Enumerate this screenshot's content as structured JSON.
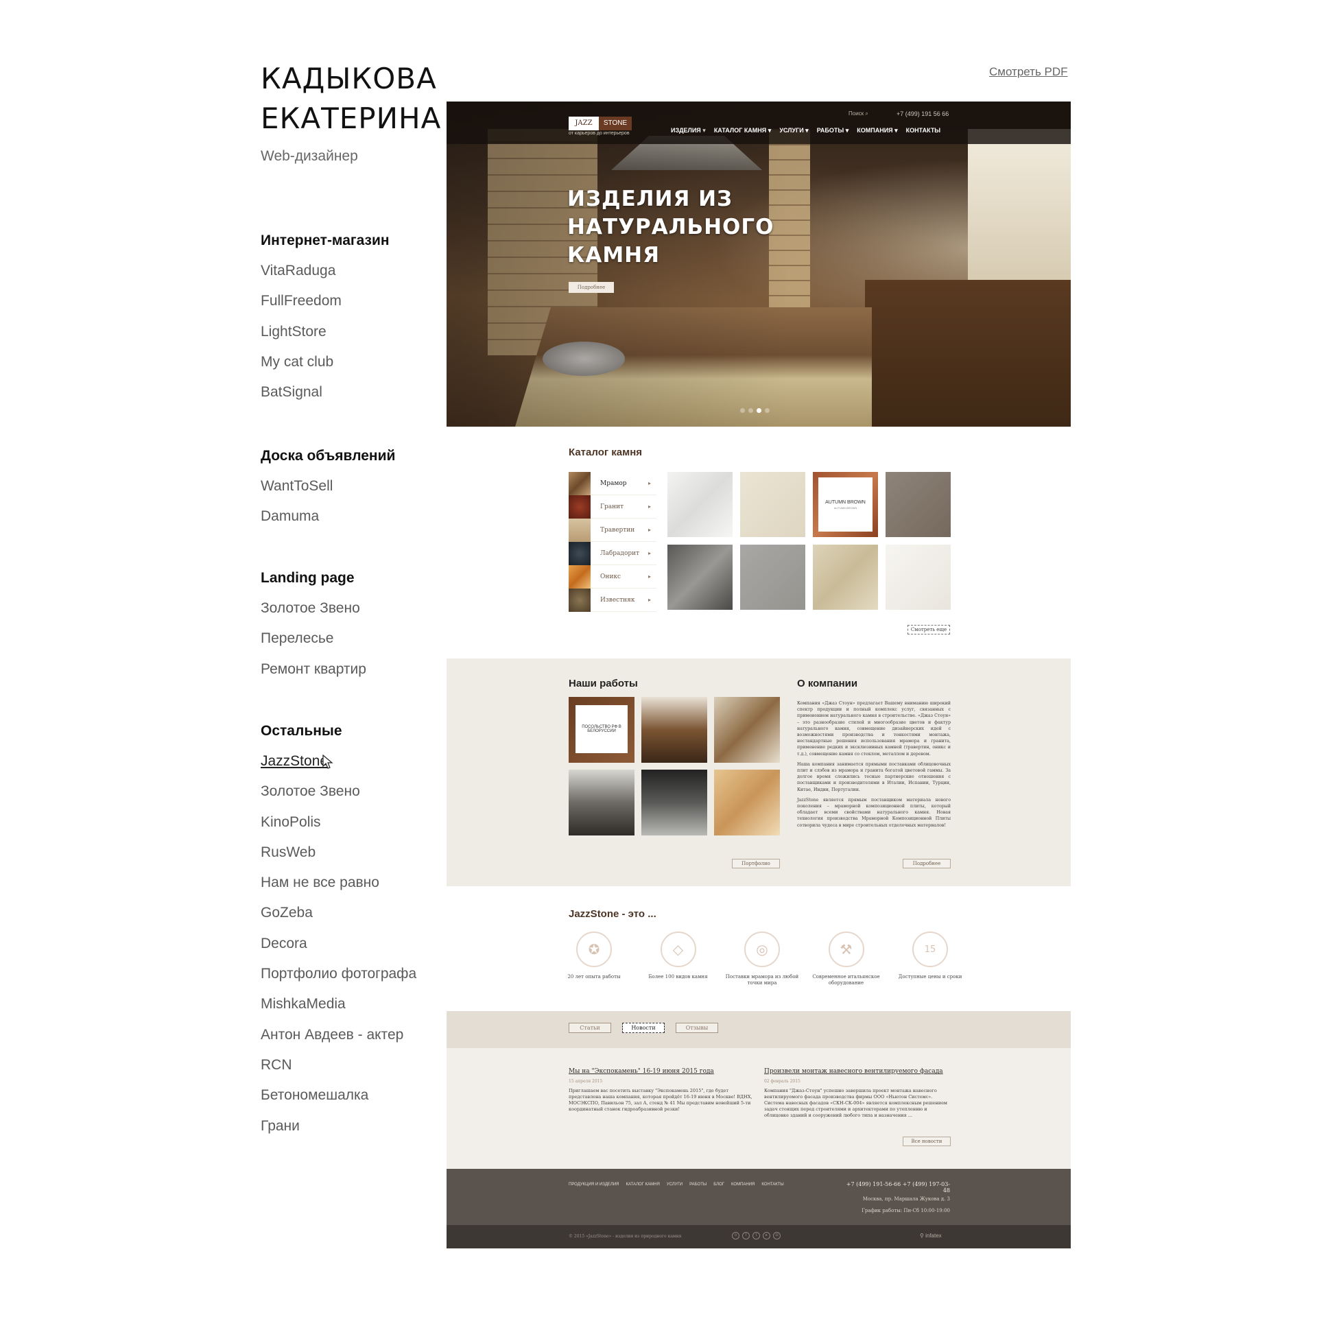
{
  "profile": {
    "name_line1": "КАДЫКОВА",
    "name_line2": "ЕКАТЕРИНА",
    "role": "Web-дизайнер"
  },
  "pdf_link": "Смотреть PDF",
  "groups": [
    {
      "title": "Интернет-магазин",
      "items": [
        "VitaRaduga",
        "FullFreedom",
        "LightStore",
        "My cat club",
        "BatSignal"
      ]
    },
    {
      "title": "Доска объявлений",
      "items": [
        "WantToSell",
        "Damuma"
      ]
    },
    {
      "title": "Landing page",
      "items": [
        "Золотое Звено",
        "Перелесье",
        "Ремонт квартир"
      ]
    },
    {
      "title": "Остальные",
      "items": [
        "JazzStone",
        "Золотое Звено",
        "KinoPolis",
        "RusWeb",
        "Нам не все равно",
        "GoZeba",
        "Decora",
        "Портфолио фотографа",
        "MishkaMedia",
        "Антон Авдеев - актер",
        "RCN",
        "Бетономешалка",
        "Грани"
      ],
      "active_index": 0
    }
  ],
  "site": {
    "logo_left": "JAZZ",
    "logo_right": "STONE",
    "logo_tagline": "от карьеров до интерьеров",
    "search_label": "Поиск",
    "phone": "+7 (499) 191 56 66",
    "nav": [
      "ИЗДЕЛИЯ",
      "КАТАЛОГ КАМНЯ",
      "УСЛУГИ",
      "РАБОТЫ",
      "КОМПАНИЯ",
      "КОНТАКТЫ"
    ],
    "hero_title": "ИЗДЕЛИЯ ИЗ НАТУРАЛЬНОГО КАМНЯ",
    "hero_button": "Подробнее",
    "slider_active": 2,
    "catalog_title": "Каталог камня",
    "catalog_menu": [
      "Мрамор",
      "Гранит",
      "Травертин",
      "Лабрадорит",
      "Оникс",
      "Известняк"
    ],
    "catalog_tile_hover_name": "AUTUMN BROWN",
    "catalog_tile_hover_sub": "AUTUMN BROWN",
    "catalog_more": "Смотреть еще",
    "works_title": "Наши работы",
    "works_hover_label": "ПОСОЛЬСТВО РФ В БЕЛОРУССИИ",
    "works_button": "Портфолио",
    "about_title": "О компании",
    "about_p1": "Компания «Джаз Стоун» предлагает Вашему вниманию широкий спектр продукции и полный комплекс услуг, связанных с применением натурального камня в строительстве. «Джаз Стоун» – это разнообразие стилей и многообразие цветов и фактур натурального камня, совмещение дизайнерских идей с возможностями производства и тонкостями монтажа, нестандартные решения использования мрамора и гранита, применение редких и эксклюзивных камней (травертин, оникс и т.д.), совмещение камня со стеклом, металлом и деревом.",
    "about_p2": "Наша компания занимается прямыми поставками облицовочных плит и слэбов из мрамора и гранита богатой цветовой гаммы. За долгое время сложились тесные партнерские отношения с поставщиками и производителями в Италии, Испании, Турции, Китае, Индии, Португалии.",
    "about_p3": "JazzStone является прямым поставщиком материала нового поколения – мраморной композиционной плиты, который обладает всеми свойствами натурального камня. Новая технология производства Мраморной Композиционной Плиты сотворила чудеса в мире строительных отделочных материалов!",
    "about_button": "Подробнее",
    "features_title": "JazzStone - это ...",
    "features": [
      {
        "icon": "medal-icon",
        "glyph": "✪",
        "text": "20 лет опыта работы"
      },
      {
        "icon": "diamond-icon",
        "glyph": "◇",
        "text": "Более 100 видов камня"
      },
      {
        "icon": "globe-icon",
        "glyph": "◎",
        "text": "Поставки мрамора из любой точки мира"
      },
      {
        "icon": "tools-icon",
        "glyph": "⚒",
        "text": "Современное итальянское оборудование"
      },
      {
        "icon": "calendar-icon",
        "glyph": "15",
        "text": "Доступные цены и сроки"
      }
    ],
    "tabs": [
      "Статьи",
      "Новости",
      "Отзывы"
    ],
    "active_tab": 1,
    "news": [
      {
        "title": "Мы на \"Экспокамень\" 16-19 июня 2015 года",
        "date": "15 апреля 2015",
        "text": "Приглашаем вас посетить выставку \"Экспокамень 2015\", где будет представлена наша компания, которая пройдёт 16-19 июня в Москве! ВДНХ, МОСЭКСПО, Павильон 75, зал А, стенд № 41 Мы представим новейший 5-ти координатный станок гидроабразивной резки!"
      },
      {
        "title": "Произвели монтаж навесного вентилируемого фасада",
        "date": "02 февраль 2015",
        "text": "Компания \"Джаз-Стоун\" успешно завершила проект монтажа навесного вентилируемого фасада производства фирмы ООО «Ньютон Системс». Система навесных фасадов «СКН-СК-004» является комплексным решением задач стоящих перед строителями и архитекторами по утеплению и облицовке зданий и сооружений любого типа и назначения ..."
      }
    ],
    "news_button": "Все новости",
    "footer_nav": [
      "ПРОДУКЦИЯ И ИЗДЕЛИЯ",
      "КАТАЛОГ КАМНЯ",
      "УСЛУГИ",
      "РАБОТЫ",
      "БЛОГ",
      "КОМПАНИЯ",
      "КОНТАКТЫ"
    ],
    "footer_phones": "+7 (499) 191-56-66     +7 (499) 197-03-48",
    "footer_address": "Москва, пр. Маршала Жукова д. 3",
    "footer_hours": "График работы: Пн-Сб 10:00-19:00",
    "copyright": "© 2015 «JazzStone» - изделия из природного камня",
    "socials": [
      "ok",
      "f",
      "tw",
      "yt",
      "ig"
    ],
    "brand": "infatex"
  },
  "colors": {
    "accent_brown": "#4e3626",
    "band_beige": "#efebe5",
    "footer": "#5b534d"
  }
}
